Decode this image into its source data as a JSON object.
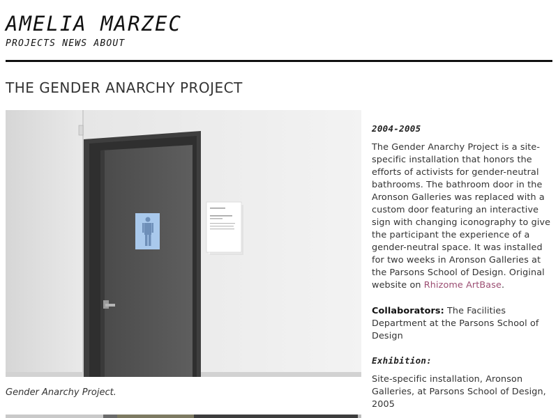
{
  "site": {
    "title": "AMELIA MARZEC",
    "nav": [
      "PROJECTS",
      "NEWS",
      "ABOUT"
    ]
  },
  "page": {
    "title": "THE GENDER ANARCHY PROJECT"
  },
  "image": {
    "caption": "Gender Anarchy Project."
  },
  "info": {
    "years": "2004-2005",
    "description": "The Gender Anarchy Project is a site-specific installation that honors the efforts of activists for gender-neutral bathrooms. The bathroom door in the Aronson Galleries was replaced with a custom door featuring an interactive sign with changing iconography to give the participant the experience of a gender-neutral space. It was installed for two weeks in Aronson Galleries at the Parsons School of Design. Original website on ",
    "link_text": "Rhizome ArtBase",
    "after_link": ".",
    "collaborators_label": "Collaborators:",
    "collaborators_text": " The Facilities Department at the Parsons School of Design",
    "exhibition_label": "Exhibition:",
    "exhibition_text": "Site-specific installation, Aronson Galleries, at Parsons School of Design, 2005"
  },
  "colors": {
    "link": "#9b4d72",
    "rule": "#111111",
    "door": "#555555"
  }
}
